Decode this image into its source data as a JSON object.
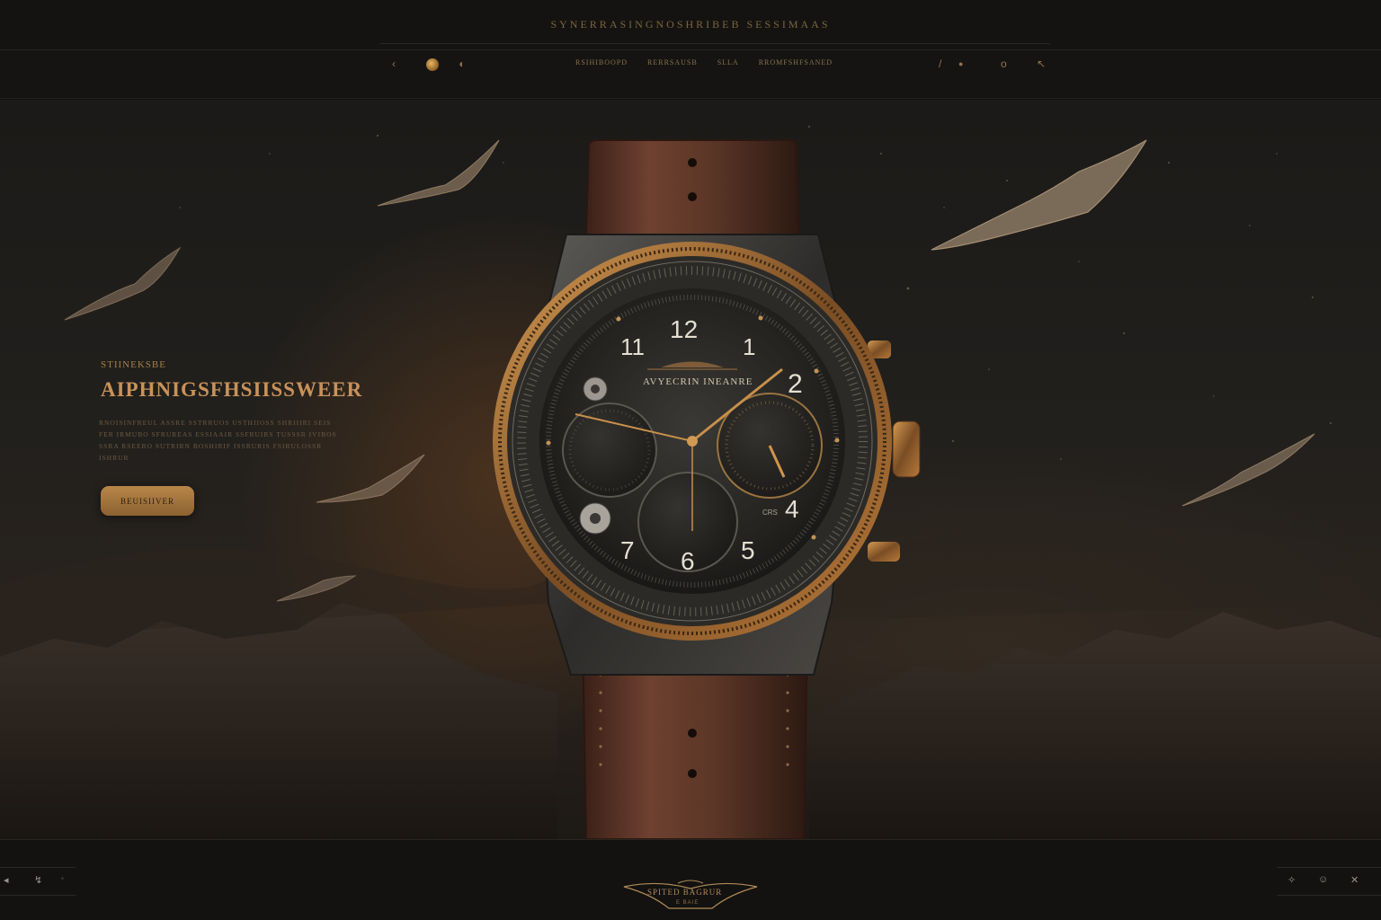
{
  "header": {
    "brand": "SYNERRASINGNOSHRIBEB SESSIMAAS"
  },
  "nav": {
    "links": [
      "RSIHIBOOPD",
      "RERRSAUSB",
      "SLLA",
      "RROMFSHFSANED"
    ],
    "left_icons": [
      "back-arrow-icon",
      "coin-icon",
      "moon-icon"
    ],
    "right_icons": [
      "pen-icon",
      "dot-icon",
      "zero-icon",
      "cursor-icon"
    ]
  },
  "hero": {
    "eyebrow": "STIINEKSBE",
    "title": "AIPHNIGSFHSIISSWEER",
    "body": "RNOISINFREUL ASSRE SSTRRUOS USTHIIOSS SHRIIIRI SEIS FER IRMUBO SFRUREAS ESSIAAIR SSFRUIRS TUSSSR IVIBOS SSRA RSEERO SUTRIRN BOSHIRIF ISSRURIS FSIRULOSSR ISHRUR",
    "cta_label": "BEUISIIVER"
  },
  "watch": {
    "dial_label": "AVYECRIN INEANRE",
    "hour_numerals": [
      "12",
      "11",
      "1",
      "2",
      "4",
      "5",
      "6",
      "7"
    ],
    "subdial_label": "CRS",
    "brand_color": "#b07a3c",
    "strap_color": "#5a3525"
  },
  "footer": {
    "emblem_text": "SPITED BAGRUR",
    "emblem_subtext": "E BAIE",
    "left_icons": [
      "sound-icon",
      "share-icon",
      "settings-icon"
    ],
    "right_icons": [
      "palette-icon",
      "user-icon",
      "close-icon"
    ]
  },
  "colors": {
    "accent": "#b8864a",
    "background": "#141311",
    "muted_text": "#6f5a40"
  }
}
